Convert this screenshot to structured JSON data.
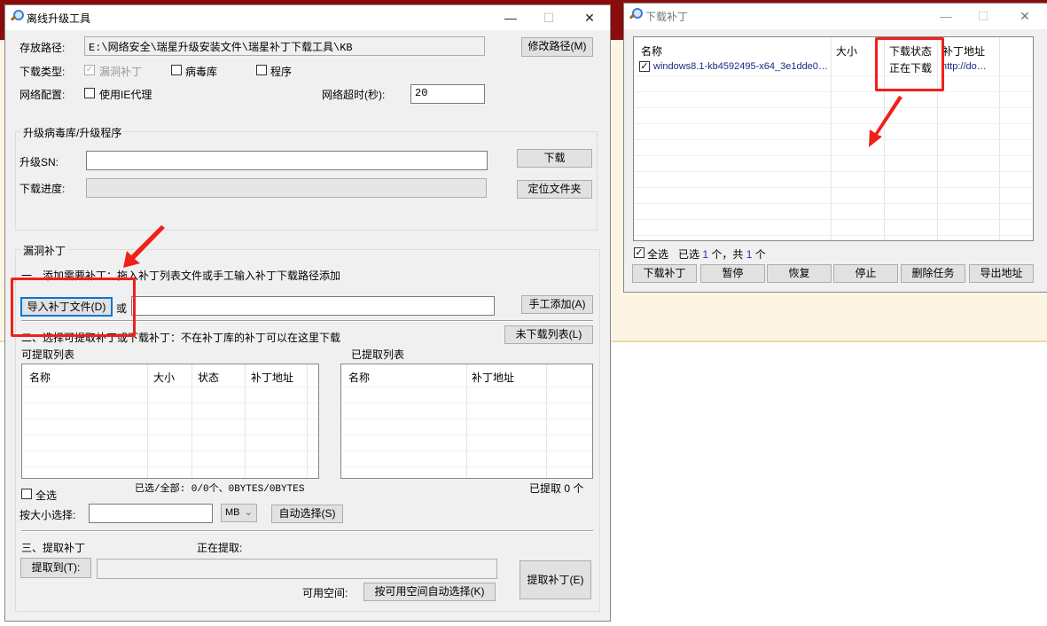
{
  "main_window": {
    "title": "离线升级工具",
    "storage_path_label": "存放路径:",
    "storage_path_value": "E:\\网络安全\\瑞星升级安装文件\\瑞星补丁下载工具\\KB",
    "modify_path_button": "修改路径(M)",
    "download_type_label": "下载类型:",
    "download_types": [
      {
        "label": "漏洞补丁",
        "checked": true,
        "disabled": true
      },
      {
        "label": "病毒库",
        "checked": false
      },
      {
        "label": "程序",
        "checked": false
      }
    ],
    "network_config_label": "网络配置:",
    "use_ie_proxy_label": "使用IE代理",
    "use_ie_proxy_checked": false,
    "timeout_label": "网络超时(秒):",
    "timeout_value": "20",
    "upgrade_group": {
      "title": "升级病毒库/升级程序",
      "sn_label": "升级SN:",
      "sn_value": "",
      "download_button": "下载",
      "progress_label": "下载进度:",
      "progress": 0,
      "locate_folder_button": "定位文件夹"
    },
    "patch_group": {
      "title": "漏洞补丁",
      "step1": "一、添加需要补丁：拖入补丁列表文件或手工输入补丁下载路径添加",
      "import_button": "导入补丁文件(D)",
      "or_label": "或",
      "manual_input_value": "",
      "manual_add_button": "手工添加(A)",
      "step2": "二、选择可提取补丁或下载补丁：不在补丁库的补丁可以在这里下载",
      "not_downloaded_button": "未下载列表(L)",
      "available_list_title": "可提取列表",
      "available_columns": [
        "名称",
        "大小",
        "状态",
        "补丁地址"
      ],
      "extracted_list_title": "已提取列表",
      "extracted_columns": [
        "名称",
        "补丁地址"
      ],
      "selected_summary": "已选/全部: 0/0个、0BYTES/0BYTES",
      "extracted_summary": "已提取 0 个",
      "select_all_label": "全选",
      "select_all_checked": false,
      "size_select_label": "按大小选择:",
      "size_value": "",
      "size_unit": "MB",
      "auto_select_button": "自动选择(S)",
      "step3": "三、提取补丁",
      "extracting_label": "正在提取:",
      "extract_to_button": "提取到(T):",
      "extract_path_value": "",
      "extract_button": "提取补丁(E)",
      "free_space_label": "可用空间:",
      "auto_select_by_space_button": "按可用空间自动选择(K)"
    }
  },
  "download_window": {
    "title": "下载补丁",
    "columns": [
      "名称",
      "大小",
      "下载状态",
      "补丁地址"
    ],
    "rows": [
      {
        "checked": true,
        "name": "windows8.1-kb4592495-x64_3e1dde0…",
        "size": "",
        "status": "正在下载",
        "url": "http://do…"
      }
    ],
    "select_all_label": "全选",
    "select_all_checked": true,
    "summary_prefix": "已选",
    "selected_count": "1",
    "summary_mid": "个，共",
    "total_count": "1",
    "summary_suffix": "个",
    "buttons": [
      "下载补丁",
      "暂停",
      "恢复",
      "停止",
      "删除任务",
      "导出地址"
    ]
  },
  "annotation_color": "#f0201a"
}
